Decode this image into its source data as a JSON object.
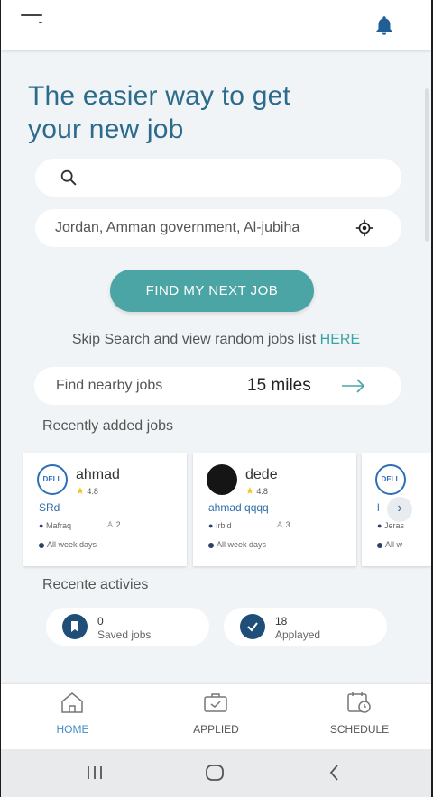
{
  "hero": {
    "line1": "The easier way to get",
    "line2": "your new job"
  },
  "search": {
    "placeholder": "",
    "icon": "search-icon"
  },
  "location": {
    "value": "Jordan, Amman government, Al-jubiha",
    "icon": "locate-icon"
  },
  "find_button": "FIND MY NEXT JOB",
  "skip": {
    "text": "Skip Search and view random jobs list ",
    "link": "HERE"
  },
  "nearby": {
    "label": "Find nearby jobs",
    "value": "15 miles"
  },
  "recent_jobs_title": "Recently added jobs",
  "jobs": [
    {
      "company": "ahmad",
      "rating": "4.8",
      "title": "SRd",
      "location": "Mafraq",
      "people": "2",
      "schedule": "All week days"
    },
    {
      "company": "dede",
      "rating": "4.8",
      "title": "ahmad qqqq",
      "location": "Irbid",
      "people": "3",
      "schedule": "All week days"
    },
    {
      "title": "l",
      "location": "Jeras",
      "schedule": "All w"
    }
  ],
  "dell_logo_text": "DELL",
  "activities_title": "Recente activies",
  "activities": [
    {
      "count": "0",
      "label": "Saved jobs"
    },
    {
      "count": "18",
      "label": "Applayed"
    }
  ],
  "nav": {
    "home": "HOME",
    "applied": "APPLIED",
    "schedule": "SCHEDULE"
  },
  "colors": {
    "primary": "#2c6b8c",
    "accent": "#4aa5a4",
    "active_nav": "#3f8fc7"
  }
}
